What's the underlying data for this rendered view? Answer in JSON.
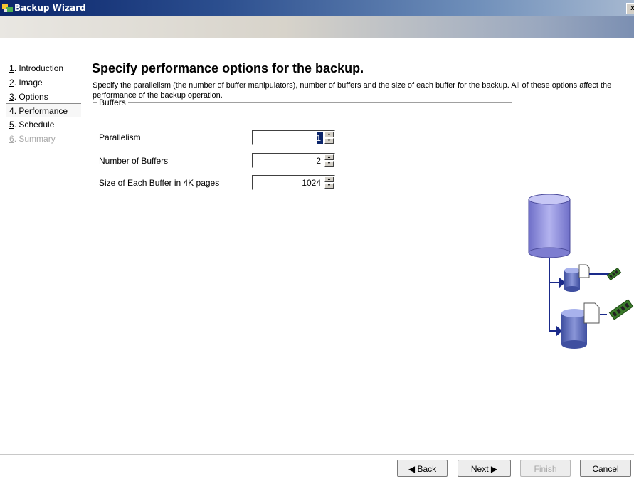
{
  "window": {
    "title": "Backup Wizard",
    "close_label": "x"
  },
  "nav": {
    "items": [
      {
        "num": "1",
        "label": ". Introduction"
      },
      {
        "num": "2",
        "label": ". Image"
      },
      {
        "num": "3",
        "label": ". Options"
      },
      {
        "num": "4",
        "label": ". Performance"
      },
      {
        "num": "5",
        "label": ". Schedule"
      },
      {
        "num": "6",
        "label": ". Summary"
      }
    ]
  },
  "main": {
    "heading": "Specify performance options for the backup.",
    "description": "Specify the parallelism (the number of buffer manipulators), number of buffers and the size of each buffer for the backup. All of these options affect the performance of the backup operation.",
    "group_title": "Buffers",
    "fields": [
      {
        "label": "Parallelism",
        "value": "1"
      },
      {
        "label": "Number of Buffers",
        "value": "2"
      },
      {
        "label": "Size of Each Buffer in 4K pages",
        "value": "1024"
      }
    ]
  },
  "buttons": {
    "back": "◀ Back",
    "next": "Next ▶",
    "finish": "Finish",
    "cancel": "Cancel"
  },
  "colors": {
    "title_bar": "#0a246a",
    "selection": "#0a246a",
    "db_cylinder": "#8e8edb"
  }
}
